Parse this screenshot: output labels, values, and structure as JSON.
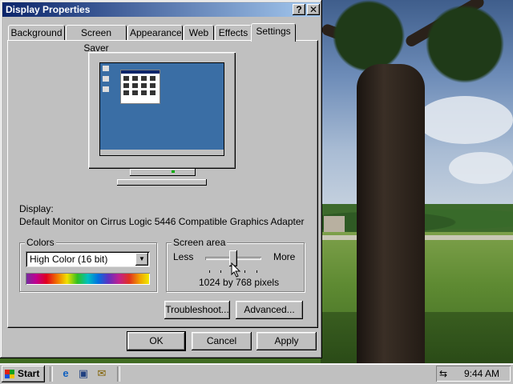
{
  "window": {
    "title": "Display Properties",
    "help_button": "?",
    "close_button": "✕"
  },
  "tabs": [
    {
      "label": "Background"
    },
    {
      "label": "Screen Saver"
    },
    {
      "label": "Appearance"
    },
    {
      "label": "Web"
    },
    {
      "label": "Effects"
    },
    {
      "label": "Settings",
      "active": true
    }
  ],
  "display": {
    "label": "Display:",
    "device": "Default Monitor on Cirrus Logic 5446 Compatible Graphics Adapter"
  },
  "colors": {
    "group_title": "Colors",
    "selected": "High Color (16 bit)"
  },
  "screen_area": {
    "group_title": "Screen area",
    "less_label": "Less",
    "more_label": "More",
    "resolution": "1024 by 768 pixels"
  },
  "buttons": {
    "troubleshoot": "Troubleshoot...",
    "advanced": "Advanced...",
    "ok": "OK",
    "cancel": "Cancel",
    "apply": "Apply"
  },
  "taskbar": {
    "start_label": "Start",
    "quick_launch_icons": [
      "internet-explorer-icon",
      "show-desktop-icon",
      "outlook-express-icon"
    ],
    "clock": "9:44 AM"
  },
  "colors_theme": {
    "titlebar_start": "#0a246a",
    "titlebar_end": "#a6caf0",
    "face": "#c0c0c0",
    "desktop_preview": "#3a6ea5"
  }
}
